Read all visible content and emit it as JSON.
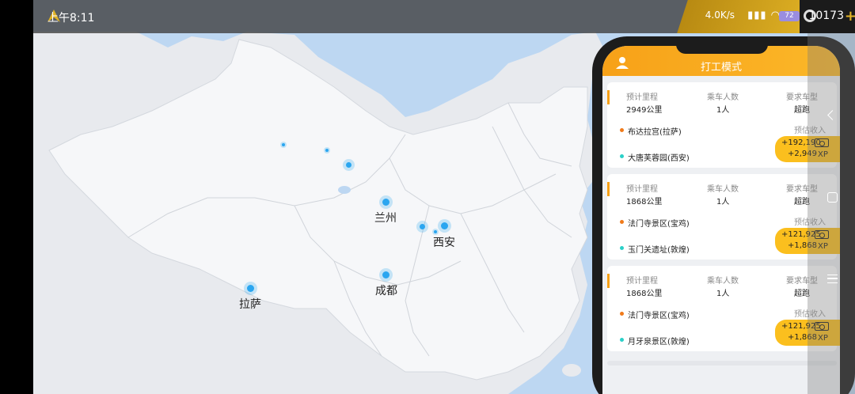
{
  "status_bar": {
    "time": "上午8:11",
    "network_speed": "4.0K/s",
    "battery_level": "72",
    "coin_count": "10173",
    "plus": "+"
  },
  "map": {
    "cities": [
      {
        "name": "兰州"
      },
      {
        "name": "西安"
      },
      {
        "name": "成都"
      },
      {
        "name": "拉萨"
      }
    ]
  },
  "phone": {
    "title": "打工模式",
    "labels": {
      "distance": "预计里程",
      "passengers": "乘车人数",
      "vehicle": "要求车型",
      "income": "预估收入",
      "xp": "XP"
    },
    "orders": [
      {
        "distance": "2949公里",
        "passengers": "1人",
        "vehicle": "超跑",
        "origin": "布达拉宫(拉萨)",
        "destination": "大唐芙蓉园(西安)",
        "income": "+192,190",
        "xp_value": "+2,949"
      },
      {
        "distance": "1868公里",
        "passengers": "1人",
        "vehicle": "超跑",
        "origin": "法门寺景区(宝鸡)",
        "destination": "玉门关遗址(敦煌)",
        "income": "+121,925",
        "xp_value": "+1,868"
      },
      {
        "distance": "1868公里",
        "passengers": "1人",
        "vehicle": "超跑",
        "origin": "法门寺景区(宝鸡)",
        "destination": "月牙泉景区(敦煌)",
        "income": "+121,925",
        "xp_value": "+1,868"
      }
    ]
  },
  "colors": {
    "accent": "#fbb829",
    "origin_dot": "#f07a1a",
    "destination_dot": "#2bd0c8",
    "map_water": "#bdd7f2",
    "map_land": "#f5f6f8",
    "city_dot": "#2ba6f0"
  }
}
